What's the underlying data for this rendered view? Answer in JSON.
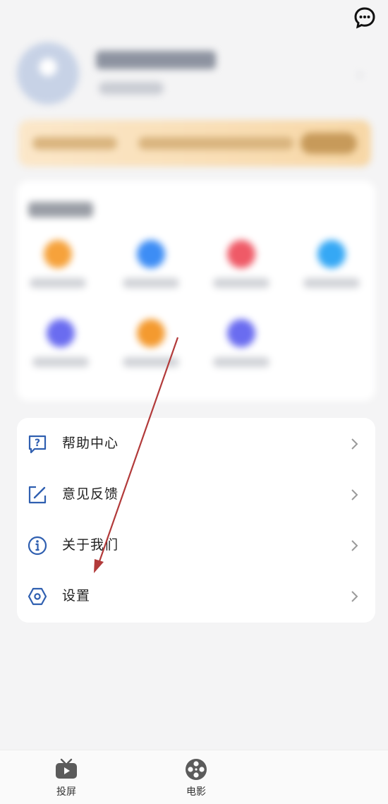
{
  "menu": {
    "items": [
      {
        "id": "help",
        "label": "帮助中心"
      },
      {
        "id": "feedback",
        "label": "意见反馈"
      },
      {
        "id": "about",
        "label": "关于我们"
      },
      {
        "id": "settings",
        "label": "设置"
      }
    ]
  },
  "bottom_nav": {
    "tabs": [
      {
        "id": "cast",
        "label": "投屏",
        "icon": "tv-icon"
      },
      {
        "id": "movie",
        "label": "电影",
        "icon": "film-reel-icon"
      }
    ]
  },
  "colors": {
    "icon_blue": "#2f5fb0",
    "annotation_arrow": "#b23a3a",
    "tool_icons": [
      "#f6a23b",
      "#3d8df5",
      "#ef5a67",
      "#35a8f5",
      "#6a6cf0",
      "#f49a2f",
      "#6a6cf0"
    ]
  }
}
